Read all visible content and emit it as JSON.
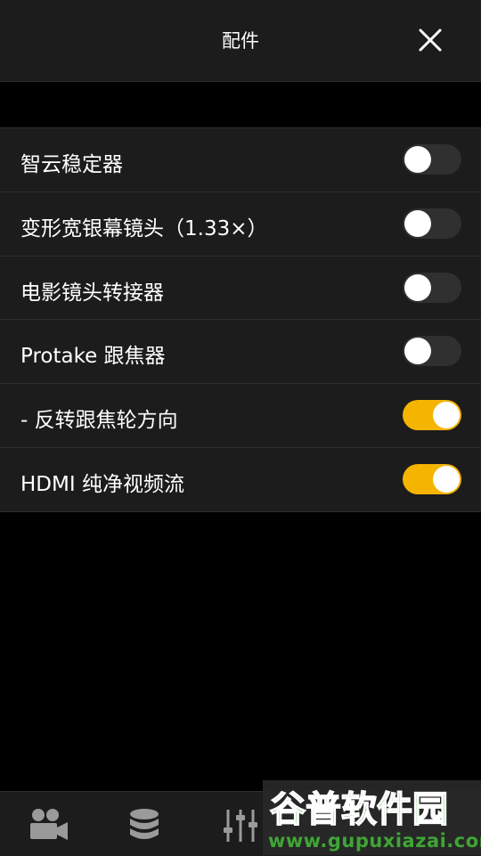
{
  "header": {
    "title": "配件"
  },
  "section1": [
    {
      "label": "智云稳定器",
      "on": false
    },
    {
      "label": "变形宽银幕镜头（1.33×）",
      "on": false
    },
    {
      "label": "电影镜头转接器",
      "on": false
    }
  ],
  "section2": [
    {
      "label": "Protake 跟焦器",
      "on": false
    },
    {
      "label": "- 反转跟焦轮方向",
      "on": true
    },
    {
      "label": "HDMI 纯净视频流",
      "on": true
    }
  ],
  "tabs": [
    {
      "icon": "camera-icon"
    },
    {
      "icon": "storage-icon"
    },
    {
      "icon": "sliders-icon"
    }
  ],
  "watermark": {
    "brand": "谷普软件园",
    "url": "www.gupuxiazai.com"
  },
  "colors": {
    "accent": "#f5b400",
    "panel": "#1c1c1c",
    "background": "#000000"
  }
}
